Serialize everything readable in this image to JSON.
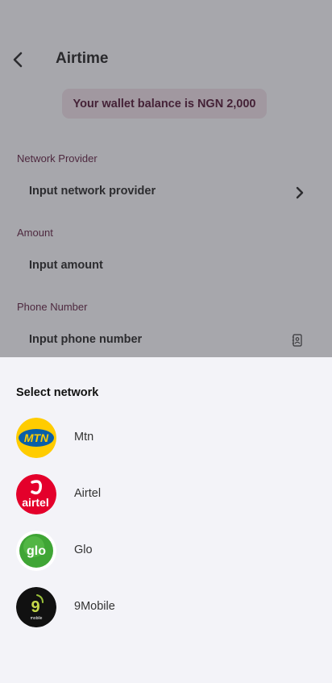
{
  "header": {
    "title": "Airtime",
    "back_icon": "chevron-left-icon"
  },
  "wallet": {
    "balance_text": "Your wallet balance is NGN 2,000"
  },
  "form": {
    "network": {
      "label": "Network Provider",
      "placeholder": "Input network provider",
      "icon": "chevron-right-icon"
    },
    "amount": {
      "label": "Amount",
      "placeholder": "Input amount"
    },
    "phone": {
      "label": "Phone Number",
      "placeholder": "Input phone number",
      "icon": "contact-book-icon"
    }
  },
  "sheet": {
    "title": "Select network",
    "networks": [
      {
        "name": "Mtn",
        "logo_text": "MTN",
        "color": "#ffcc00"
      },
      {
        "name": "Airtel",
        "logo_text": "airtel",
        "color": "#e4002b"
      },
      {
        "name": "Glo",
        "logo_text": "glo",
        "color": "#3fa535"
      },
      {
        "name": "9Mobile",
        "logo_text": "9",
        "sub_text": "mobile",
        "color": "#111111"
      }
    ]
  },
  "colors": {
    "accent": "#5a1a3c",
    "balance_bg": "#eadbe4",
    "sheet_bg": "#f3f3f8"
  }
}
